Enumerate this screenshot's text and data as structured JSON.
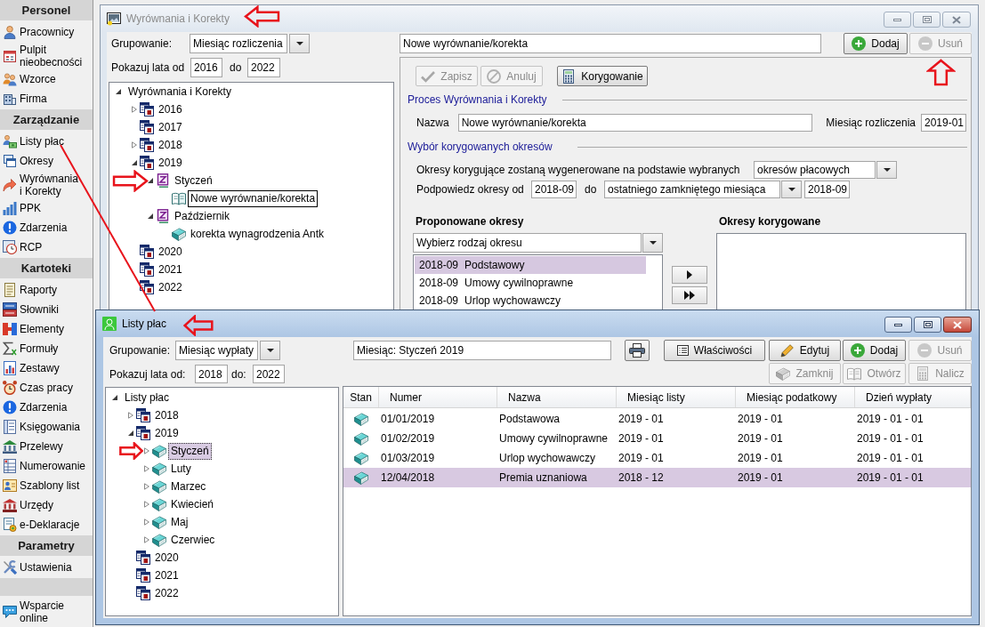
{
  "sidebar": {
    "sections": [
      {
        "title": "Personel",
        "items": [
          "Pracownicy",
          "Pulpit nieobecności",
          "Wzorce",
          "Firma"
        ]
      },
      {
        "title": "Zarządzanie",
        "items": [
          "Listy płac",
          "Okresy",
          "Wyrównania i Korekty",
          "PPK",
          "Zdarzenia",
          "RCP"
        ]
      },
      {
        "title": "Kartoteki",
        "items": [
          "Raporty",
          "Słowniki",
          "Elementy",
          "Formuły",
          "Zestawy",
          "Czas pracy",
          "Zdarzenia",
          "Księgowania",
          "Przelewy",
          "Numerowanie",
          "Szablony list",
          "Urzędy",
          "e-Deklaracje"
        ]
      },
      {
        "title": "Parametry",
        "items": [
          "Ustawienia"
        ]
      },
      {
        "items": [
          "Wsparcie online"
        ]
      }
    ]
  },
  "corrections_window": {
    "title": "Wyrównania i Korekty",
    "active": false,
    "grouping_label": "Grupowanie:",
    "grouping_value": "Miesiąc rozliczenia",
    "years_label": "Pokazuj lata od",
    "year_from": "2016",
    "years_to_label": "do",
    "year_to": "2022",
    "tree": [
      {
        "label": "Wyrównania i Korekty",
        "expanded": true,
        "selected": false,
        "children": [
          {
            "label": "2016",
            "kind": "year",
            "expanded": false,
            "selected": false
          },
          {
            "label": "2017",
            "kind": "year",
            "selected": false
          },
          {
            "label": "2018",
            "kind": "year",
            "expanded": false,
            "selected": false
          },
          {
            "label": "2019",
            "kind": "year",
            "expanded": true,
            "selected": false,
            "children": [
              {
                "label": "Styczeń",
                "kind": "period",
                "expanded": true,
                "selected": false,
                "children": [
                  {
                    "label": "Nowe wyrównanie/korekta",
                    "kind": "draft",
                    "selected": true
                  }
                ]
              },
              {
                "label": "Październik",
                "kind": "period",
                "expanded": true,
                "selected": false,
                "children": [
                  {
                    "label": "korekta wynagrodzenia Antk",
                    "kind": "book",
                    "selected": false
                  }
                ]
              }
            ]
          },
          {
            "label": "2020",
            "kind": "year",
            "selected": false
          },
          {
            "label": "2021",
            "kind": "year",
            "selected": false
          },
          {
            "label": "2022",
            "kind": "year",
            "selected": false
          }
        ]
      }
    ],
    "name_field": "Nowe wyrównanie/korekta",
    "actions": [
      {
        "label": "Dodaj",
        "kind": "add",
        "disabled": false
      },
      {
        "label": "Usuń",
        "kind": "remove",
        "disabled": true
      }
    ],
    "editor_toolbar": [
      {
        "label": "Zapisz",
        "kind": "save",
        "disabled": true
      },
      {
        "label": "Anuluj",
        "kind": "cancel",
        "disabled": true
      },
      {
        "label": "Korygowanie",
        "kind": "calculate",
        "disabled": false
      }
    ],
    "process": {
      "heading": "Proces Wyrównania i Korekty",
      "name_label": "Nazwa",
      "name_value": "Nowe wyrównanie/korekta",
      "month_label": "Miesiąc rozliczenia",
      "month_value": "2019-01"
    },
    "period_selection": {
      "heading": "Wybór korygowanych okresów",
      "basis_label": "Okresy korygujące zostaną wygenerowane na podstawie wybranych",
      "basis_value": "okresów płacowych",
      "hint_label": "Podpowiedz okresy od",
      "hint_from": "2018-09",
      "hint_to_label": "do",
      "hint_to_mode": "ostatniego zamkniętego miesiąca",
      "hint_to": "2018-09"
    },
    "proposed": {
      "heading": "Proponowane okresy",
      "filter": "Wybierz rodzaj okresu",
      "items": [
        {
          "period": "2018-09",
          "name": "Podstawowy",
          "selected": true
        },
        {
          "period": "2018-09",
          "name": "Umowy cywilnoprawne",
          "selected": false
        },
        {
          "period": "2018-09",
          "name": "Urlop wychowawczy",
          "selected": false
        }
      ]
    },
    "corrected": {
      "heading": "Okresy korygowane"
    }
  },
  "payroll_window": {
    "title": "Listy płac",
    "active": true,
    "grouping_label": "Grupowanie:",
    "grouping_value": "Miesiąc wypłaty",
    "years_label": "Pokazuj lata od:",
    "year_from": "2018",
    "years_to_label": "do:",
    "year_to": "2022",
    "tree": [
      {
        "label": "Listy płac",
        "expanded": true,
        "selected": false,
        "children": [
          {
            "label": "2018",
            "kind": "year",
            "expanded": false,
            "selected": false
          },
          {
            "label": "2019",
            "kind": "year",
            "expanded": true,
            "selected": false,
            "children": [
              {
                "label": "Styczeń",
                "kind": "book",
                "expanded": false,
                "selected": true
              },
              {
                "label": "Luty",
                "kind": "book",
                "expanded": false,
                "selected": false
              },
              {
                "label": "Marzec",
                "kind": "book",
                "expanded": false,
                "selected": false
              },
              {
                "label": "Kwiecień",
                "kind": "book",
                "expanded": false,
                "selected": false
              },
              {
                "label": "Maj",
                "kind": "book",
                "expanded": false,
                "selected": false
              },
              {
                "label": "Czerwiec",
                "kind": "book",
                "expanded": false,
                "selected": false
              }
            ]
          },
          {
            "label": "2020",
            "kind": "year",
            "selected": false
          },
          {
            "label": "2021",
            "kind": "year",
            "selected": false
          },
          {
            "label": "2022",
            "kind": "year",
            "selected": false
          }
        ]
      }
    ],
    "caption_field": "Miesiąc: Styczeń 2019",
    "toolbar": [
      {
        "kind": "print",
        "disabled": false
      },
      {
        "label": "Właściwości",
        "kind": "properties",
        "disabled": false
      },
      {
        "label": "Edytuj",
        "kind": "edit",
        "disabled": false
      },
      {
        "label": "Dodaj",
        "kind": "add",
        "disabled": false
      },
      {
        "label": "Usuń",
        "kind": "remove",
        "disabled": true
      }
    ],
    "toolbar_row_2": [
      {
        "label": "Zamknij",
        "kind": "close",
        "disabled": true
      },
      {
        "label": "Otwórz",
        "kind": "open",
        "disabled": true
      },
      {
        "label": "Nalicz",
        "kind": "calculate",
        "disabled": true
      }
    ],
    "table": {
      "status_column": "Stan",
      "columns": [
        "Numer",
        "Nazwa",
        "Miesiąc listy",
        "Miesiąc podatkowy",
        "Dzień wypłaty"
      ],
      "rows": [
        {
          "cells": [
            "01/01/2019",
            "Podstawowa",
            "2019 - 01",
            "2019 - 01",
            "2019 - 01 - 01"
          ],
          "selected": false
        },
        {
          "cells": [
            "01/02/2019",
            "Umowy cywilnoprawne",
            "2019 - 01",
            "2019 - 01",
            "2019 - 01 - 01"
          ],
          "selected": false
        },
        {
          "cells": [
            "01/03/2019",
            "Urlop wychowawczy",
            "2019 - 01",
            "2019 - 01",
            "2019 - 01 - 01"
          ],
          "selected": false
        },
        {
          "cells": [
            "12/04/2018",
            "Premia uznaniowa",
            "2018 - 12",
            "2019 - 01",
            "2019 - 01 - 01"
          ],
          "selected": true
        }
      ]
    }
  }
}
